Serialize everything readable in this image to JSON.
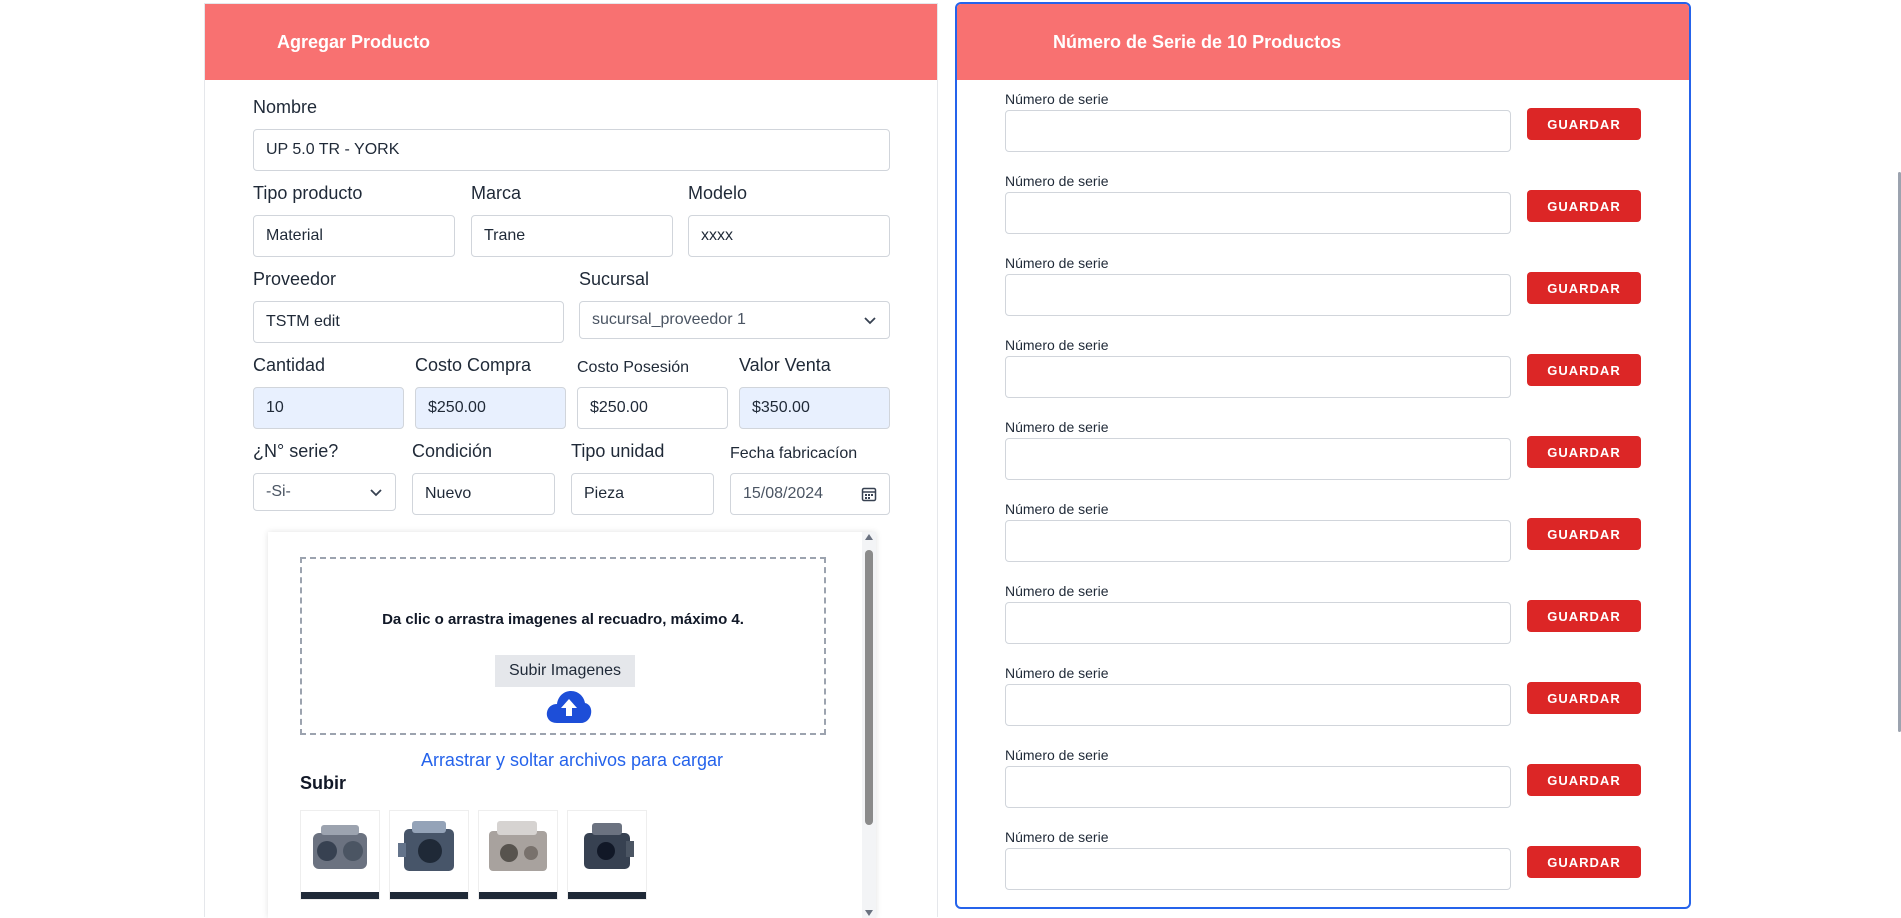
{
  "left": {
    "title": "Agregar Producto",
    "nombre": {
      "label": "Nombre",
      "value": "UP 5.0 TR - YORK"
    },
    "tipo_producto": {
      "label": "Tipo producto",
      "value": "Material"
    },
    "marca": {
      "label": "Marca",
      "value": "Trane"
    },
    "modelo": {
      "label": "Modelo",
      "value": "xxxx"
    },
    "proveedor": {
      "label": "Proveedor",
      "value": "TSTM edit"
    },
    "sucursal": {
      "label": "Sucursal",
      "value": "sucursal_proveedor 1"
    },
    "cantidad": {
      "label": "Cantidad",
      "value": "10"
    },
    "costo_compra": {
      "label": "Costo Compra",
      "value": "$250.00"
    },
    "costo_posesion": {
      "label": "Costo Posesión",
      "value": "$250.00"
    },
    "valor_venta": {
      "label": "Valor Venta",
      "value": "$350.00"
    },
    "n_serie": {
      "label": "¿N° serie?",
      "value": "-Si-"
    },
    "condicion": {
      "label": "Condición",
      "value": "Nuevo"
    },
    "tipo_unidad": {
      "label": "Tipo unidad",
      "value": "Pieza"
    },
    "fecha": {
      "label": "Fecha fabricacíon",
      "value": "15/08/2024"
    },
    "upload": {
      "instructions": "Da clic o arrastra imagenes al recuadro, máximo 4.",
      "button": "Subir Imagenes",
      "drag_text": "Arrastrar y soltar archivos para cargar",
      "subir_title": "Subir"
    }
  },
  "right": {
    "title": "Número de Serie de 10 Productos",
    "rows": [
      {
        "label": "Número de serie",
        "value": "",
        "button": "GUARDAR"
      },
      {
        "label": "Número de serie",
        "value": "",
        "button": "GUARDAR"
      },
      {
        "label": "Número de serie",
        "value": "",
        "button": "GUARDAR"
      },
      {
        "label": "Número de serie",
        "value": "",
        "button": "GUARDAR"
      },
      {
        "label": "Número de serie",
        "value": "",
        "button": "GUARDAR"
      },
      {
        "label": "Número de serie",
        "value": "",
        "button": "GUARDAR"
      },
      {
        "label": "Número de serie",
        "value": "",
        "button": "GUARDAR"
      },
      {
        "label": "Número de serie",
        "value": "",
        "button": "GUARDAR"
      },
      {
        "label": "Número de serie",
        "value": "",
        "button": "GUARDAR"
      },
      {
        "label": "Número de serie",
        "value": "",
        "button": "GUARDAR"
      }
    ]
  },
  "colors": {
    "header": "#f87171",
    "accent_blue": "#2563eb",
    "save_red": "#dc2626"
  },
  "icons": [
    "chevron-down-icon",
    "calendar-icon",
    "cloud-upload-icon"
  ]
}
